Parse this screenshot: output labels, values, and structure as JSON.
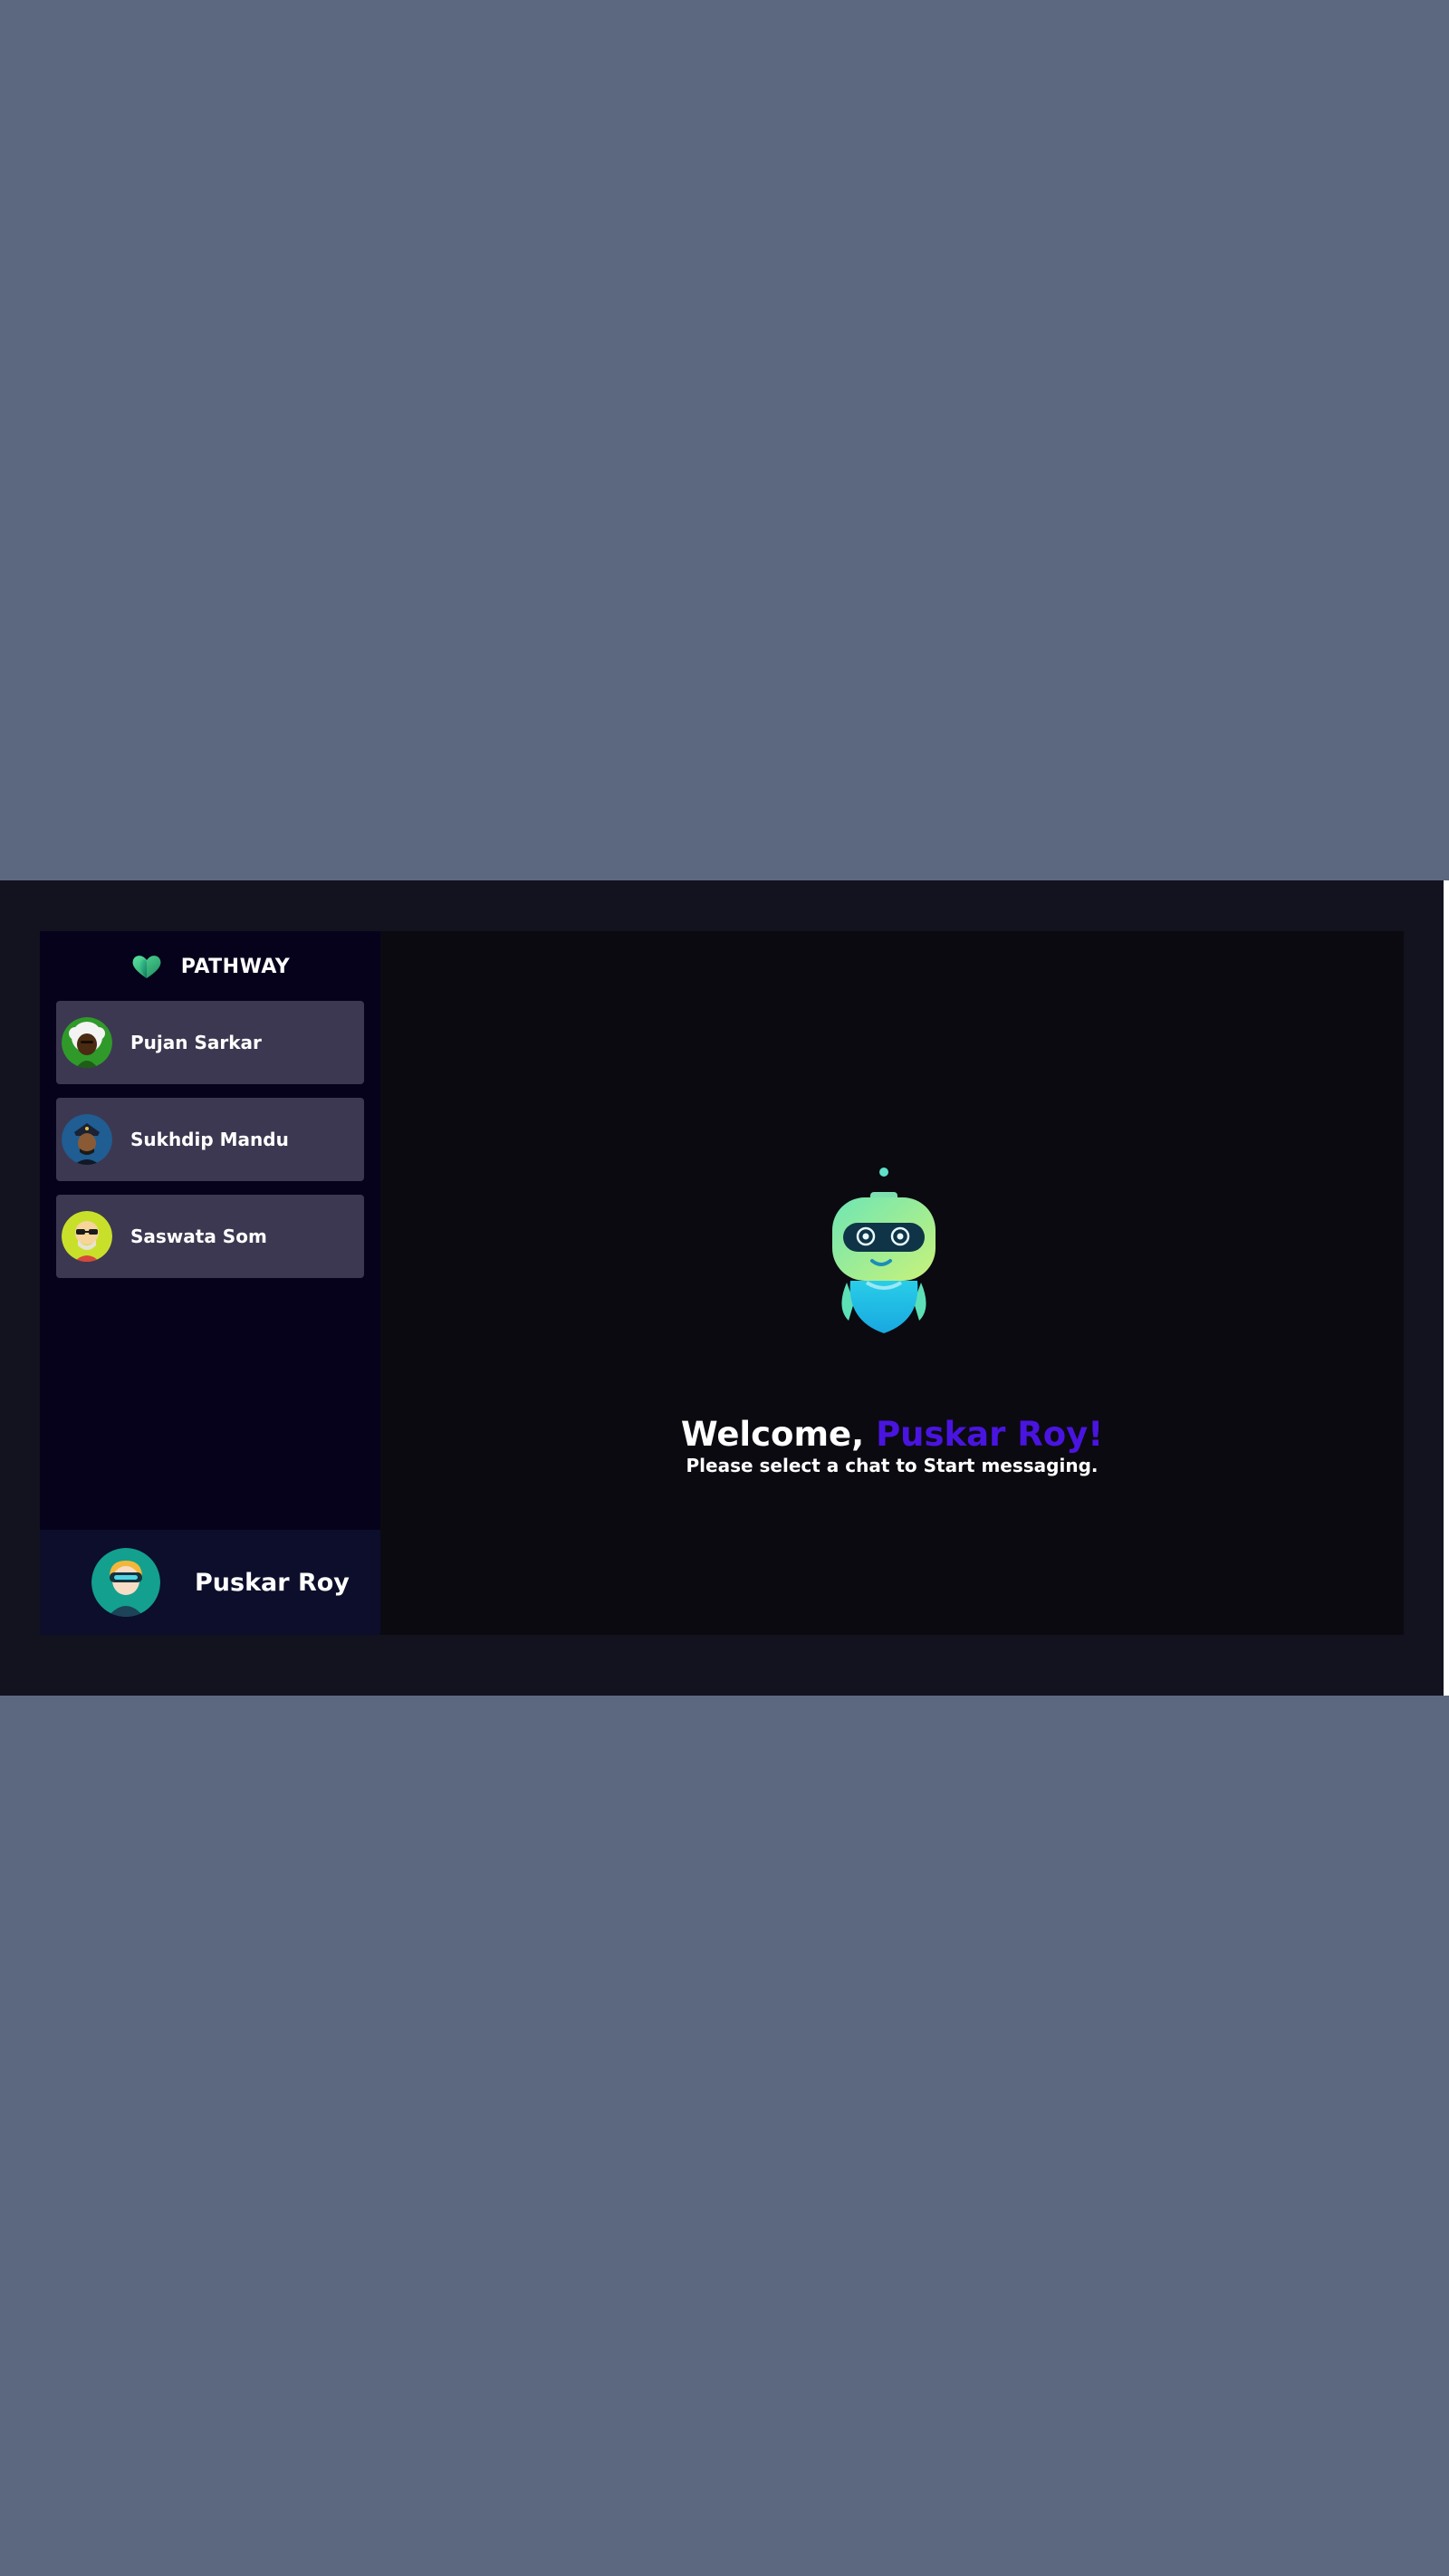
{
  "brand": {
    "name": "PATHWAY",
    "logo_icon": "heart-logo-icon"
  },
  "contacts": [
    {
      "name": "Pujan Sarkar",
      "avatar_icon": "avatar-afro-icon"
    },
    {
      "name": "Sukhdip Mandu",
      "avatar_icon": "avatar-police-icon"
    },
    {
      "name": "Saswata Som",
      "avatar_icon": "avatar-sunglasses-icon"
    }
  ],
  "current_user": {
    "name": "Puskar Roy",
    "avatar_icon": "avatar-vr-headset-icon"
  },
  "welcome": {
    "prefix": "Welcome, ",
    "name": "Puskar Roy!",
    "subtitle": "Please select a chat to Start messaging.",
    "mascot_icon": "robot-mascot-icon"
  },
  "colors": {
    "page_background": "#5c687f",
    "stage_background": "#13121f",
    "sidebar_background": "#06021c",
    "contact_card": "#3d3851",
    "profile_bar": "#0c0e2b",
    "main_panel": "#0b0a11",
    "accent": "#4a14e0"
  }
}
